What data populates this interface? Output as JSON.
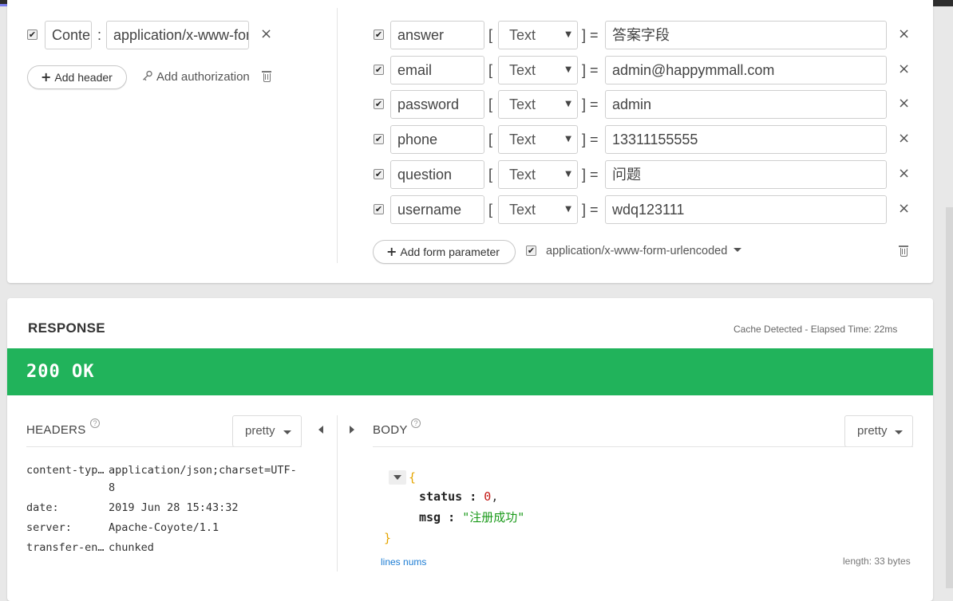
{
  "request": {
    "headers": [
      {
        "enabled": true,
        "name": "Content-Type",
        "value": "application/x-www-form-urlencoded"
      }
    ],
    "add_header_label": "Add header",
    "add_authorization_label": "Add authorization",
    "form_params": [
      {
        "enabled": true,
        "name": "answer",
        "type": "Text",
        "value": "答案字段"
      },
      {
        "enabled": true,
        "name": "email",
        "type": "Text",
        "value": "admin@happymmall.com"
      },
      {
        "enabled": true,
        "name": "password",
        "type": "Text",
        "value": "admin"
      },
      {
        "enabled": true,
        "name": "phone",
        "type": "Text",
        "value": "13311155555"
      },
      {
        "enabled": true,
        "name": "question",
        "type": "Text",
        "value": "问题"
      },
      {
        "enabled": true,
        "name": "username",
        "type": "Text",
        "value": "wdq123111"
      }
    ],
    "add_form_param_label": "Add form parameter",
    "encoding_label": "application/x-www-form-urlencoded"
  },
  "response": {
    "title": "RESPONSE",
    "cache_info": "Cache Detected - Elapsed Time: 22ms",
    "status": "200 OK",
    "headers_label": "HEADERS",
    "body_label": "BODY",
    "headers_format": "pretty",
    "body_format": "pretty",
    "headers": [
      {
        "key": "content-typ…",
        "value_line1": "application/json;charset=UTF-",
        "value_line2": "8"
      },
      {
        "key": "date:",
        "value": "2019 Jun 28 15:43:32"
      },
      {
        "key": "server:",
        "value": "Apache-Coyote/1.1"
      },
      {
        "key": "transfer-en…",
        "value": "chunked"
      }
    ],
    "body": {
      "open_brace": "{",
      "close_brace": "}",
      "fields": [
        {
          "key": "status",
          "value": "0",
          "kind": "number",
          "trail": ","
        },
        {
          "key": "msg",
          "value": "\"注册成功\"",
          "kind": "string",
          "trail": ""
        }
      ]
    },
    "lines_nums_label": "lines nums",
    "length_info": "length: 33 bytes"
  },
  "colors": {
    "status_ok": "#21b35b",
    "link": "#1a7bd3",
    "json_brace": "#e5a500",
    "json_number": "#c41a16",
    "json_string": "#1a9a1a"
  },
  "icons": {
    "checkbox": "check-mark",
    "remove": "close-icon",
    "key": "key-icon",
    "trash": "trash-icon",
    "plus": "plus-icon",
    "help": "help-icon",
    "caret": "caret-down-icon",
    "collapse_left": "triangle-left-icon",
    "expand_right": "triangle-right-icon"
  }
}
